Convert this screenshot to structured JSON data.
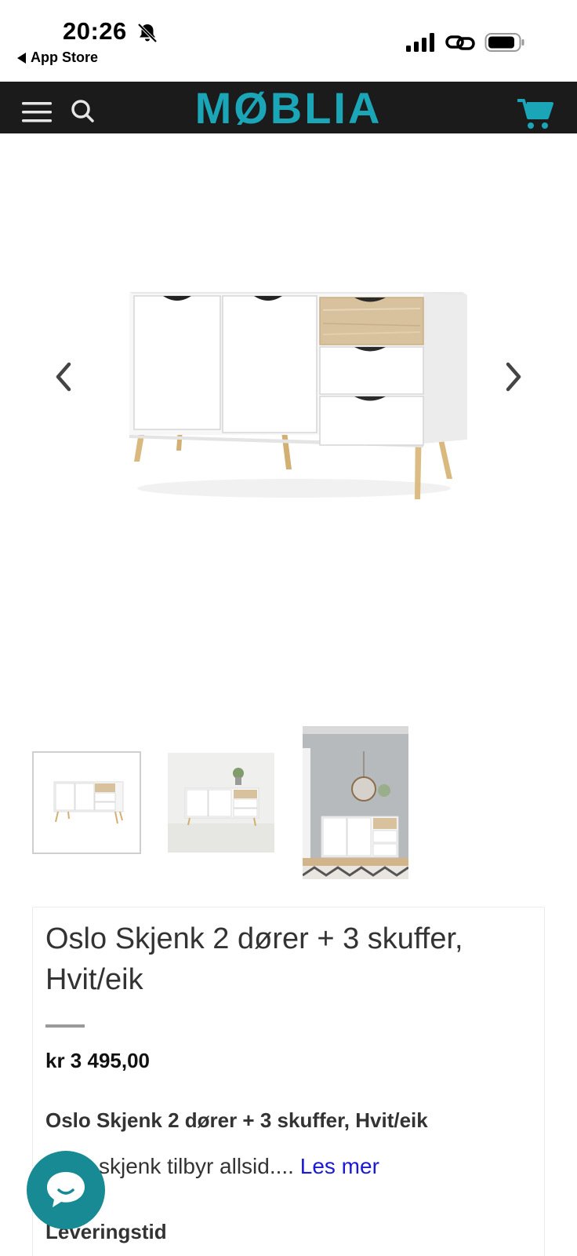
{
  "status_bar": {
    "time": "20:26",
    "back_app": "App Store",
    "icons": [
      "bell-muted-icon",
      "signal-icon",
      "link-icon",
      "battery-icon"
    ]
  },
  "header": {
    "logo": "MØBLIA",
    "icons": [
      "menu-icon",
      "search-icon",
      "cart-icon"
    ],
    "background": "#1b1b1b",
    "brand_color": "#1ba6b8"
  },
  "gallery": {
    "main_image": "white sideboard with oak drawer and legs",
    "thumbnail_count": 3,
    "selected_thumbnail": 1
  },
  "product": {
    "title": "Oslo Skjenk 2 dører + 3 skuffer, Hvit/eik",
    "price": "kr 3 495,00",
    "subtitle": "Oslo Skjenk 2 dører + 3 skuffer, Hvit/eik",
    "description": "skjenk tilbyr allsid....",
    "read_more": "Les mer",
    "delivery_heading": "Leveringstid"
  },
  "chat": {
    "icon": "chat-bubble-icon",
    "color": "#178a94"
  }
}
